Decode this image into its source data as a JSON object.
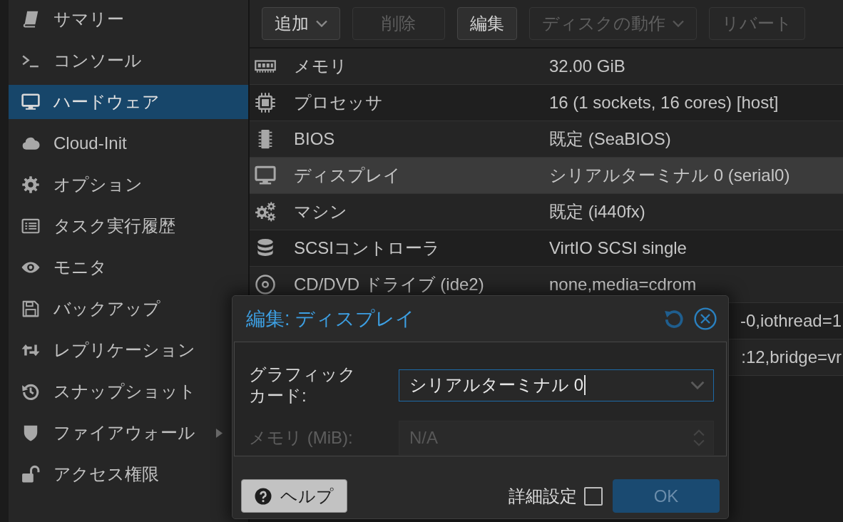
{
  "sidebar": {
    "items": [
      {
        "label": "サマリー",
        "selected": false,
        "kind": "page"
      },
      {
        "label": "コンソール",
        "selected": false,
        "kind": "page"
      },
      {
        "label": "ハードウェア",
        "selected": true,
        "kind": "page"
      },
      {
        "label": "Cloud-Init",
        "selected": false,
        "kind": "page"
      },
      {
        "label": "オプション",
        "selected": false,
        "kind": "page"
      },
      {
        "label": "タスク実行履歴",
        "selected": false,
        "kind": "page"
      },
      {
        "label": "モニタ",
        "selected": false,
        "kind": "page"
      },
      {
        "label": "バックアップ",
        "selected": false,
        "kind": "page"
      },
      {
        "label": "レプリケーション",
        "selected": false,
        "kind": "page"
      },
      {
        "label": "スナップショット",
        "selected": false,
        "kind": "page"
      },
      {
        "label": "ファイアウォール",
        "selected": false,
        "kind": "group"
      },
      {
        "label": "アクセス権限",
        "selected": false,
        "kind": "page"
      }
    ]
  },
  "toolbar": {
    "buttons": [
      {
        "label": "追加",
        "disabled": false,
        "dropdown": true
      },
      {
        "label": "削除",
        "disabled": true,
        "dropdown": false
      },
      {
        "label": "編集",
        "disabled": false,
        "dropdown": false
      },
      {
        "label": "ディスクの動作",
        "disabled": true,
        "dropdown": true
      },
      {
        "label": "リバート",
        "disabled": true,
        "dropdown": false
      }
    ]
  },
  "hardware_table": {
    "rows": [
      {
        "label": "メモリ",
        "value": "32.00 GiB",
        "selected": false
      },
      {
        "label": "プロセッサ",
        "value": "16 (1 sockets, 16 cores) [host]",
        "selected": false
      },
      {
        "label": "BIOS",
        "value": "既定 (SeaBIOS)",
        "selected": false
      },
      {
        "label": "ディスプレイ",
        "value": "シリアルターミナル 0 (serial0)",
        "selected": true
      },
      {
        "label": "マシン",
        "value": "既定 (i440fx)",
        "selected": false
      },
      {
        "label": "SCSIコントローラ",
        "value": "VirtIO SCSI single",
        "selected": false
      },
      {
        "label": "CD/DVD ドライブ (ide2)",
        "value": "none,media=cdrom",
        "selected": false
      },
      {
        "value": "-0,iothread=1",
        "selected": false
      },
      {
        "value": ":12,bridge=vr",
        "selected": false
      }
    ]
  },
  "dialog": {
    "title": "編集: ディスプレイ",
    "fields": [
      {
        "kind": "combo",
        "label": "グラフィックカード:",
        "value": "シリアルターミナル 0",
        "focused": true,
        "disabled": false
      },
      {
        "kind": "number",
        "label": "メモリ (MiB):",
        "placeholder": "N/A",
        "focused": false,
        "disabled": true
      }
    ],
    "help_button": {
      "label": "ヘルプ"
    },
    "advanced": {
      "label": "詳細設定",
      "checked": false
    },
    "ok_button": {
      "label": "OK",
      "disabled": true
    }
  }
}
